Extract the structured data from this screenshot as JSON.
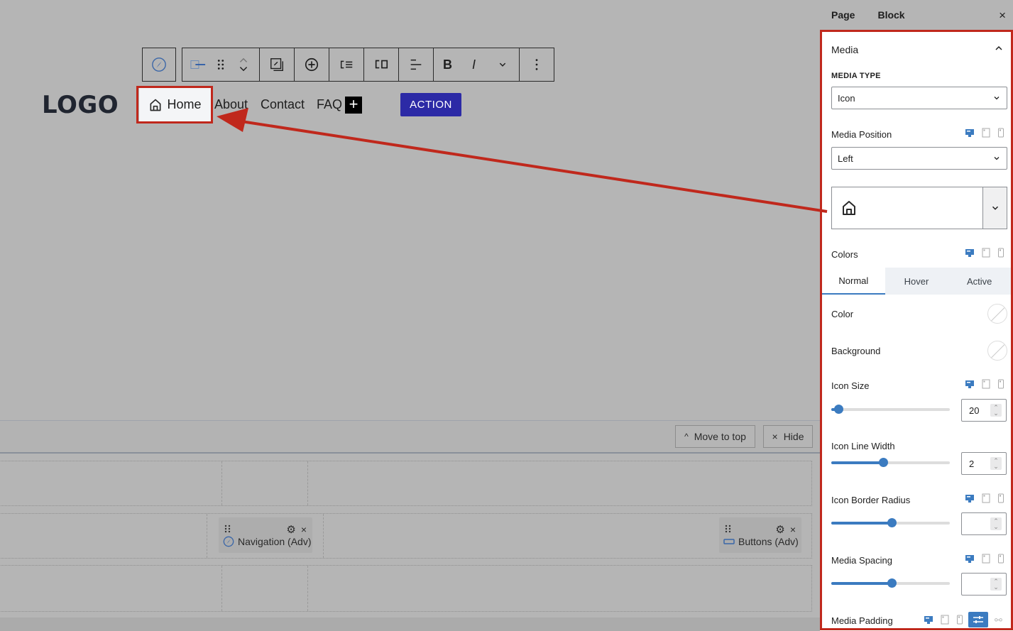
{
  "toolbar": {
    "block_icon": "navigation-compass-icon",
    "buttons": [
      {
        "name": "link-item-icon"
      },
      {
        "name": "drag-handle-icon"
      },
      {
        "name": "move-up-down-icon"
      },
      {
        "name": "replace-media-icon"
      },
      {
        "name": "add-item-icon"
      },
      {
        "name": "indent-list-icon"
      },
      {
        "name": "submenu-icon"
      },
      {
        "name": "align-left-icon"
      },
      {
        "name": "bold-icon",
        "label": "B"
      },
      {
        "name": "italic-icon",
        "label": "I"
      },
      {
        "name": "more-formatting-chevron-icon"
      },
      {
        "name": "options-kebab-icon"
      }
    ]
  },
  "header": {
    "logo": "LOGO",
    "nav_items": [
      "Home",
      "About",
      "Contact",
      "FAQ"
    ],
    "home_icon": "home-icon",
    "add_label": "+",
    "action_label": "ACTION"
  },
  "lower": {
    "move_to_top": "Move to top",
    "move_to_top_icon": "^",
    "hide": "Hide",
    "hide_icon": "×",
    "widgets": [
      {
        "label": "Navigation (Adv)",
        "icon": "navigation-compass-icon"
      },
      {
        "label": "Buttons (Adv)",
        "icon": "buttons-icon"
      }
    ],
    "close_glyph": "×"
  },
  "sidebar": {
    "tabs": [
      "Page",
      "Block"
    ],
    "close": "×",
    "section_title": "Media",
    "media_type_label": "MEDIA TYPE",
    "media_type_value": "Icon",
    "media_position_label": "Media Position",
    "media_position_value": "Left",
    "selected_icon": "home-icon",
    "colors_label": "Colors",
    "color_tabs": [
      "Normal",
      "Hover",
      "Active"
    ],
    "active_color_tab": "Normal",
    "color_label": "Color",
    "background_label": "Background",
    "icon_size": {
      "label": "Icon Size",
      "value": "20",
      "slider_fraction": 0.06
    },
    "icon_line_width": {
      "label": "Icon Line Width",
      "value": "2",
      "slider_fraction": 0.44
    },
    "icon_border_radius": {
      "label": "Icon Border Radius",
      "value": "",
      "slider_fraction": 0.51
    },
    "media_spacing": {
      "label": "Media Spacing",
      "value": "",
      "slider_fraction": 0.51
    },
    "media_padding_label": "Media Padding",
    "accent_color": "#3b7bc0",
    "highlight_color": "#c0281c"
  }
}
